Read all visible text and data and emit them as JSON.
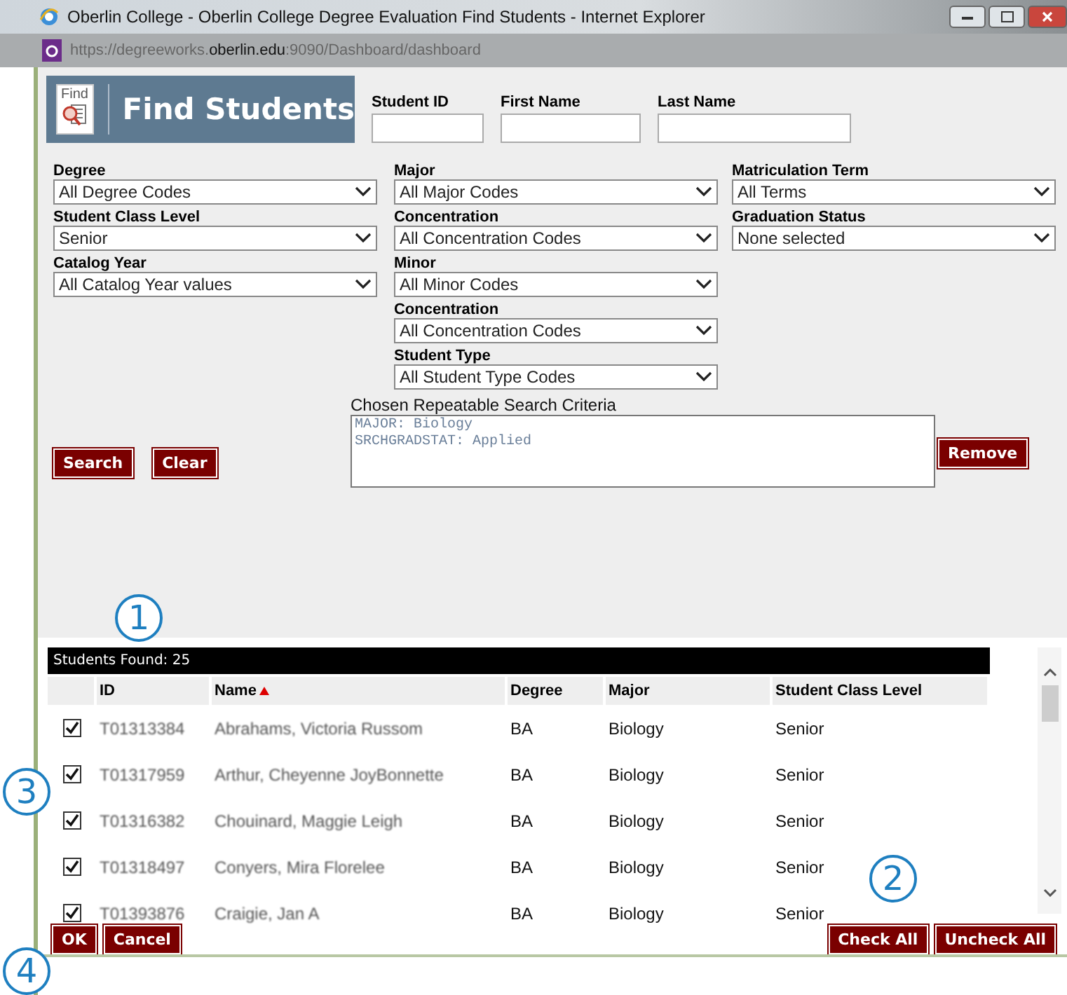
{
  "window": {
    "title": "Oberlin College - Oberlin College Degree Evaluation Find Students - Internet Explorer"
  },
  "address_bar": {
    "url_prefix": "https://degreeworks.",
    "url_domain": "oberlin.edu",
    "url_suffix": ":9090/Dashboard/dashboard"
  },
  "header": {
    "logo_text": "Find",
    "title": "Find Students"
  },
  "name_fields": [
    {
      "label": "Student ID"
    },
    {
      "label": "First Name"
    },
    {
      "label": "Last Name"
    }
  ],
  "filter_columns": [
    [
      {
        "label": "Degree",
        "value": "All Degree Codes"
      },
      {
        "label": "Student Class Level",
        "value": "Senior"
      },
      {
        "label": "Catalog Year",
        "value": "All Catalog Year values"
      }
    ],
    [
      {
        "label": "Major",
        "value": "All Major Codes"
      },
      {
        "label": "Concentration",
        "value": "All Concentration Codes"
      },
      {
        "label": "Minor",
        "value": "All Minor Codes"
      },
      {
        "label": "Concentration",
        "value": "All Concentration Codes"
      },
      {
        "label": "Student Type",
        "value": "All Student Type Codes"
      }
    ],
    [
      {
        "label": "Matriculation Term",
        "value": "All Terms"
      },
      {
        "label": "Graduation Status",
        "value": "None selected"
      }
    ]
  ],
  "criteria": {
    "label": "Chosen Repeatable Search Criteria",
    "lines": [
      "MAJOR: Biology",
      "SRCHGRADSTAT: Applied"
    ],
    "remove_button": "Remove"
  },
  "search_buttons": [
    "Search",
    "Clear"
  ],
  "results": {
    "count_label": "Students Found: 25",
    "columns": [
      {
        "label": "ID",
        "sorted": false
      },
      {
        "label": "Name",
        "sorted": true
      },
      {
        "label": "Degree",
        "sorted": false
      },
      {
        "label": "Major",
        "sorted": false
      },
      {
        "label": "Student Class Level",
        "sorted": false
      }
    ],
    "rows": [
      {
        "checked": true,
        "id": "T01313384",
        "name": "Abrahams, Victoria Russom",
        "degree": "BA",
        "major": "Biology",
        "class_level": "Senior"
      },
      {
        "checked": true,
        "id": "T01317959",
        "name": "Arthur, Cheyenne JoyBonnette",
        "degree": "BA",
        "major": "Biology",
        "class_level": "Senior"
      },
      {
        "checked": true,
        "id": "T01316382",
        "name": "Chouinard, Maggie Leigh",
        "degree": "BA",
        "major": "Biology",
        "class_level": "Senior"
      },
      {
        "checked": true,
        "id": "T01318497",
        "name": "Conyers, Mira Florelee",
        "degree": "BA",
        "major": "Biology",
        "class_level": "Senior"
      },
      {
        "checked": true,
        "id": "T01393876",
        "name": "Craigie, Jan A",
        "degree": "BA",
        "major": "Biology",
        "class_level": "Senior"
      }
    ]
  },
  "footer_buttons_left": [
    "OK",
    "Cancel"
  ],
  "footer_buttons_right": [
    "Check All",
    "Uncheck All"
  ],
  "annotations": [
    "1",
    "2",
    "3",
    "4"
  ]
}
